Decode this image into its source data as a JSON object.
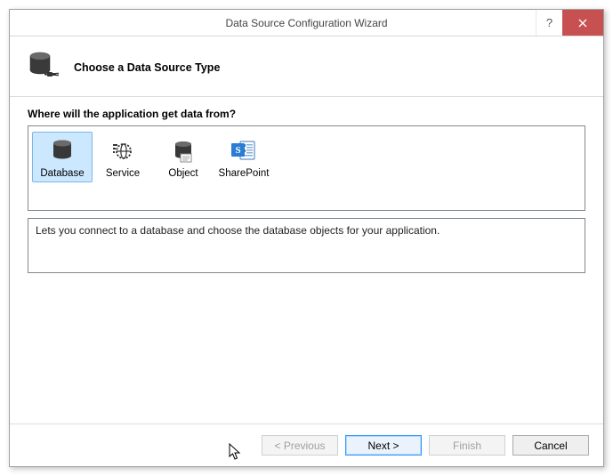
{
  "titlebar": {
    "title": "Data Source Configuration Wizard"
  },
  "header": {
    "title": "Choose a Data Source Type"
  },
  "content": {
    "question": "Where will the application get data from?",
    "options": [
      {
        "label": "Database"
      },
      {
        "label": "Service"
      },
      {
        "label": "Object"
      },
      {
        "label": "SharePoint"
      }
    ],
    "description": "Lets you connect to a database and choose the database objects for your application."
  },
  "footer": {
    "previous": "< Previous",
    "next": "Next >",
    "finish": "Finish",
    "cancel": "Cancel"
  }
}
